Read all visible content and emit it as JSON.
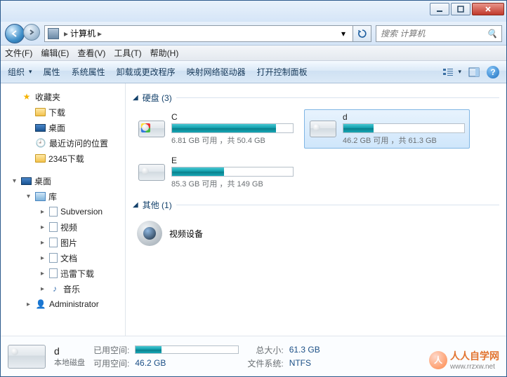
{
  "address": {
    "root_label": "计算机",
    "search_placeholder": "搜索 计算机"
  },
  "menu": {
    "file": "文件(F)",
    "edit": "编辑(E)",
    "view": "查看(V)",
    "tools": "工具(T)",
    "help": "帮助(H)"
  },
  "toolbar": {
    "organize": "组织",
    "properties": "属性",
    "system_properties": "系统属性",
    "uninstall": "卸载或更改程序",
    "map_drive": "映射网络驱动器",
    "control_panel": "打开控制面板"
  },
  "sidebar": {
    "favorites": "收藏夹",
    "fav_items": [
      {
        "label": "下载",
        "icon": "folder"
      },
      {
        "label": "桌面",
        "icon": "monitor"
      },
      {
        "label": "最近访问的位置",
        "icon": "recent"
      },
      {
        "label": "2345下载",
        "icon": "folder"
      }
    ],
    "desktop": "桌面",
    "libraries": "库",
    "lib_items": [
      {
        "label": "Subversion",
        "icon": "doc"
      },
      {
        "label": "视频",
        "icon": "doc"
      },
      {
        "label": "图片",
        "icon": "doc"
      },
      {
        "label": "文档",
        "icon": "doc"
      },
      {
        "label": "迅雷下载",
        "icon": "doc"
      },
      {
        "label": "音乐",
        "icon": "note"
      }
    ],
    "administrator": "Administrator"
  },
  "groups": {
    "hdd": {
      "title": "硬盘 (3)"
    },
    "other": {
      "title": "其他 (1)"
    }
  },
  "drives": [
    {
      "label": "C",
      "free": "6.81 GB",
      "total": "50.4 GB",
      "pct": 86,
      "win": true,
      "selected": false
    },
    {
      "label": "d",
      "free": "46.2 GB",
      "total": "61.3 GB",
      "pct": 25,
      "win": false,
      "selected": true
    },
    {
      "label": "E",
      "free": "85.3 GB",
      "total": "149 GB",
      "pct": 43,
      "win": false,
      "selected": false
    }
  ],
  "other_device": {
    "label": "视频设备"
  },
  "drive_info_tmpl": {
    "free_word": "可用",
    "sep": "，共"
  },
  "details": {
    "name": "d",
    "type": "本地磁盘",
    "used_label": "已用空间:",
    "free_label": "可用空间:",
    "free_value": "46.2 GB",
    "total_label": "总大小:",
    "total_value": "61.3 GB",
    "fs_label": "文件系统:",
    "fs_value": "NTFS",
    "used_pct": 25
  },
  "watermark": {
    "text": "人人自学网",
    "url": "www.rrzxw.net"
  }
}
